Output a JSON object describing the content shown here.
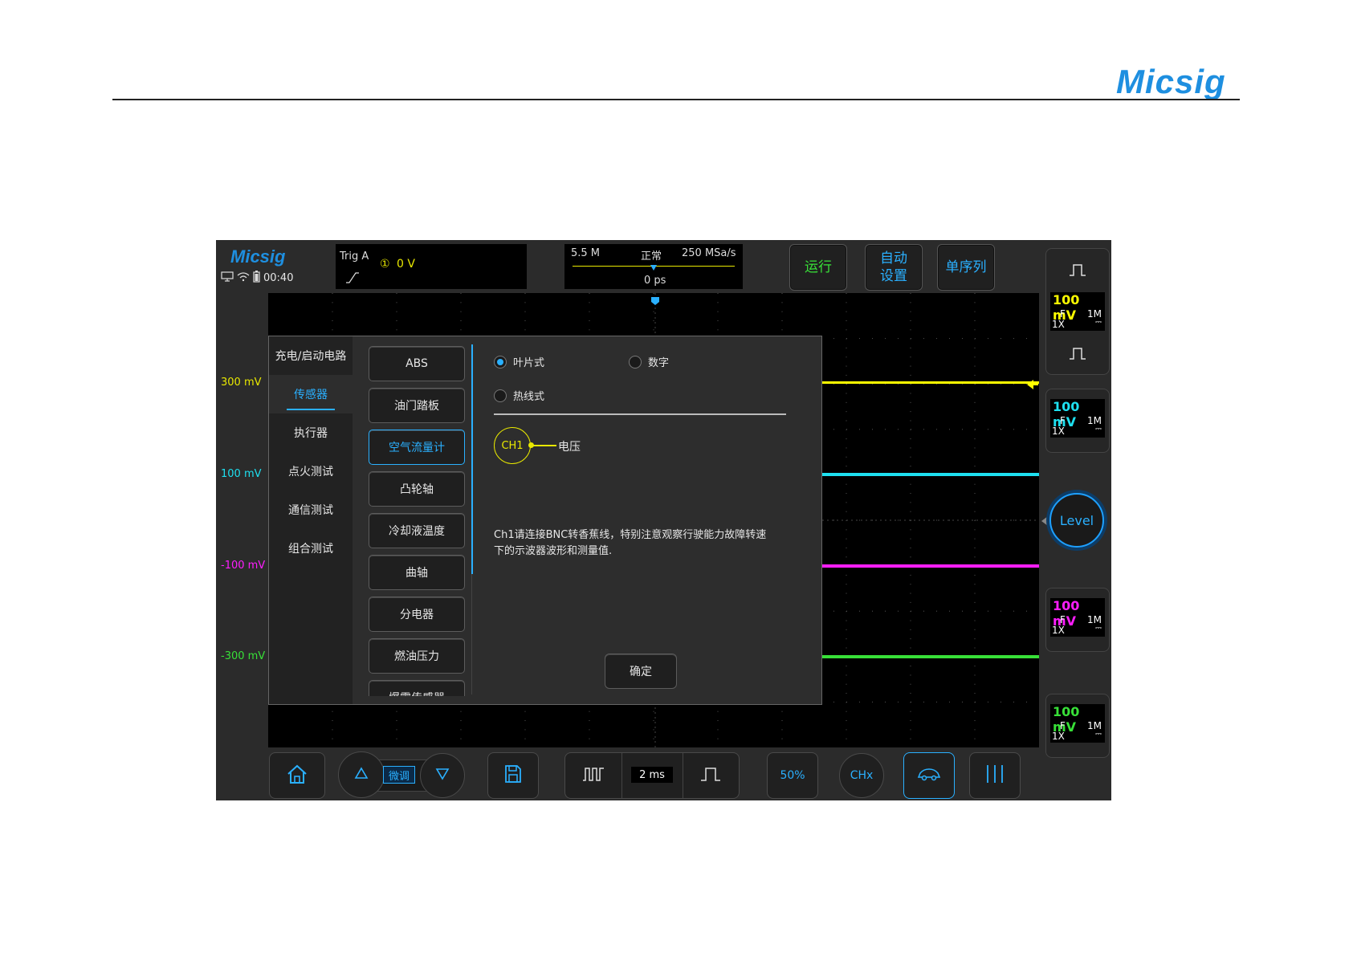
{
  "page": {
    "logo": "Micsig"
  },
  "header": {
    "logo": "Micsig",
    "time": "00:40",
    "trig": {
      "title": "Trig  A",
      "channel_mark": "①",
      "value": "0  V"
    },
    "timebase": {
      "memory": "5.5 M",
      "mode": "正常",
      "sample_rate": "250 MSa/s",
      "offset": "0 ps"
    },
    "buttons": {
      "run": "运行",
      "auto_line1": "自动",
      "auto_line2": "设置",
      "single": "单序列"
    }
  },
  "axis_labels": [
    {
      "text": "300 mV",
      "color": "#e8e800"
    },
    {
      "text": "100 mV",
      "color": "#1ee0f0"
    },
    {
      "text": "-100 mV",
      "color": "#ff1eff"
    },
    {
      "text": "-300 mV",
      "color": "#38e038"
    }
  ],
  "channels": [
    {
      "scale": "100 mV",
      "coupling": "F",
      "impedance": "1M",
      "probe": "1X",
      "color": "#ffff00"
    },
    {
      "scale": "100 mV",
      "coupling": "F",
      "impedance": "1M",
      "probe": "1X",
      "color": "#1ee0f0"
    },
    {
      "scale": "100 mV",
      "coupling": "F",
      "impedance": "1M",
      "probe": "1X",
      "color": "#ff1eff"
    },
    {
      "scale": "100 mV",
      "coupling": "F",
      "impedance": "1M",
      "probe": "1X",
      "color": "#38e038"
    }
  ],
  "level_knob": "Level",
  "dialog": {
    "categories": [
      "充电/启动电路",
      "传感器",
      "执行器",
      "点火测试",
      "通信测试",
      "组合测试"
    ],
    "selected_category": "传感器",
    "sub_items": [
      "ABS",
      "油门踏板",
      "空气流量计",
      "凸轮轴",
      "冷却液温度",
      "曲轴",
      "分电器",
      "燃油压力",
      "爆震传感器"
    ],
    "selected_sub": "空气流量计",
    "options": {
      "vane": "叶片式",
      "digital": "数字",
      "hotwire": "热线式"
    },
    "selected_option": "叶片式",
    "probe": {
      "channel": "CH1",
      "signal": "电压"
    },
    "instruction_line1": "Ch1请连接BNC转香蕉线，特别注意观察行驶能力故障转速",
    "instruction_line2": "下的示波器波形和测量值.",
    "confirm": "确定"
  },
  "bottom_bar": {
    "fine": "微调",
    "timebase": "2 ms",
    "fifty": "50%",
    "chx": "CHx"
  },
  "colors": {
    "accent": "#2ab0ff",
    "ch1": "#ffff00",
    "ch2": "#1ee0f0",
    "ch3": "#ff1eff",
    "ch4": "#38e038"
  }
}
